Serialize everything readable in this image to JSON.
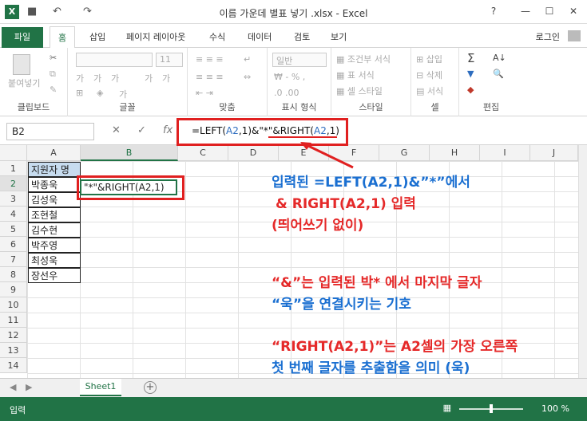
{
  "window": {
    "title": "이름 가운데 별표 넣기 .xlsx - Excel",
    "excel_logo": "X",
    "undo_icon": "↶",
    "redo_icon": "↷",
    "help_icon": "?",
    "min_icon": "—",
    "max_icon": "☐",
    "close_icon": "✕"
  },
  "ribbon_tabs": {
    "file": "파일",
    "home": "홈",
    "insert": "삽입",
    "page_layout": "페이지 레이아웃",
    "formulas": "수식",
    "data": "데이터",
    "review": "검토",
    "view": "보기",
    "login": "로그인"
  },
  "ribbon": {
    "clipboard_label": "클립보드",
    "paste_label": "붙여넣기",
    "font_label": "글꼴",
    "font_size": "11",
    "align_label": "맞춤",
    "number_label": "표시 형식",
    "number_format": "일반",
    "styles_label": "스타일",
    "cond_format": "조건부 서식",
    "table_format": "표 서식",
    "cell_style": "셀 스타일",
    "cells_label": "셀",
    "insert": "삽입",
    "delete": "삭제",
    "format": "서식",
    "editing_label": "편집"
  },
  "formula_bar": {
    "name_box": "B2",
    "cancel": "✕",
    "enter": "✓",
    "fx": "fx",
    "f_part1": "=LEFT(",
    "f_ref1": "A2",
    "f_part2": ",1)&\"*\"&RIGHT(",
    "f_ref2": "A2",
    "f_part3": ",1)"
  },
  "columns": [
    "A",
    "B",
    "C",
    "D",
    "E",
    "F",
    "G",
    "H",
    "I",
    "J"
  ],
  "rows": [
    "1",
    "2",
    "3",
    "4",
    "5",
    "6",
    "7",
    "8",
    "9",
    "10",
    "11",
    "12",
    "13",
    "14"
  ],
  "column_a": [
    "지원자 명",
    "박종욱",
    "김성욱",
    "조현철",
    "김수현",
    "박주영",
    "최성욱",
    "장선우"
  ],
  "active_cell_text": "\"*\"&RIGHT(A2,1)",
  "annotations": {
    "line1": "입력된 =LEFT(A2,1)&”*”에서",
    "line2": "&  RIGHT(A2,1) 입력",
    "line3": "(띄어쓰기 없이)",
    "line4": "“&”는 입력된 박* 에서 마지막 글자",
    "line5": "“욱”을 연결시키는 기호",
    "line6": "“RIGHT(A2,1)”는 A2셀의 가장 오른쪽",
    "line7": "첫 번째 글자를 추출함을 의미 (욱)"
  },
  "sheet_tab": "Sheet1",
  "add_sheet": "+",
  "status": {
    "mode": "입력",
    "zoom": "100 %"
  },
  "colors": {
    "accent": "#217346",
    "annotation_red": "#e52929",
    "annotation_blue": "#1a6fd1",
    "header_fill": "#c7dcef"
  }
}
